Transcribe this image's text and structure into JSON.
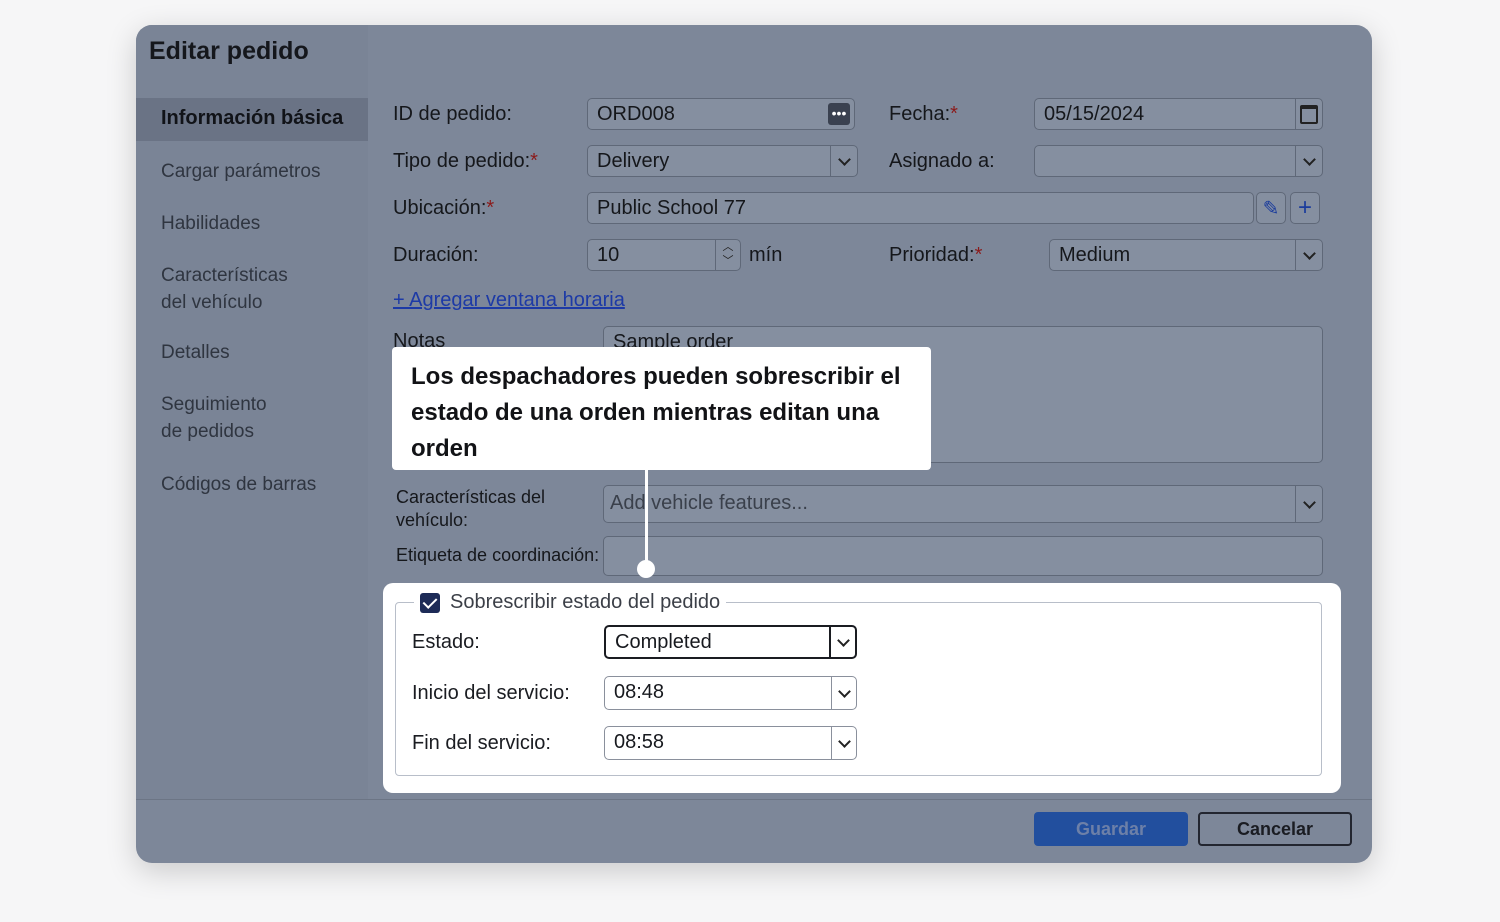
{
  "dialog": {
    "title": "Editar pedido"
  },
  "sidebar": {
    "items": [
      {
        "label": "Información básica"
      },
      {
        "label": "Cargar parámetros"
      },
      {
        "label": "Habilidades"
      },
      {
        "label": "Características del vehículo"
      },
      {
        "label": "Detalles"
      },
      {
        "label": "Seguimiento de pedidos"
      },
      {
        "label": "Códigos de barras"
      }
    ]
  },
  "form": {
    "order_id": {
      "label": "ID de pedido:",
      "value": "ORD008"
    },
    "date": {
      "label": "Fecha:",
      "value": "05/15/2024"
    },
    "order_type": {
      "label": "Tipo de pedido:",
      "value": "Delivery"
    },
    "assigned": {
      "label": "Asignado a:",
      "value": ""
    },
    "location": {
      "label": "Ubicación:",
      "value": "Public School 77"
    },
    "duration": {
      "label": "Duración:",
      "value": "10",
      "unit": "mín"
    },
    "priority": {
      "label": "Prioridad:",
      "value": "Medium"
    },
    "add_window_link": "+ Agregar ventana horaria",
    "notes": {
      "label": "Notas",
      "value": "Sample order"
    },
    "vehicle_features": {
      "label": "Características del vehículo:",
      "placeholder": "Add vehicle features..."
    },
    "coordination_tag": {
      "label": "Etiqueta de coordinación:",
      "value": ""
    },
    "required_mark": "*"
  },
  "override": {
    "checkbox_label": "Sobrescribir estado del pedido",
    "status": {
      "label": "Estado:",
      "value": "Completed"
    },
    "service_start": {
      "label": "Inicio del servicio:",
      "value": "08:48"
    },
    "service_end": {
      "label": "Fin del servicio:",
      "value": "08:58"
    }
  },
  "callout": {
    "text": "Los despachadores pueden sobrescribir el estado de una orden mientras editan una orden"
  },
  "footer": {
    "save_label": "Guardar",
    "cancel_label": "Cancelar"
  }
}
